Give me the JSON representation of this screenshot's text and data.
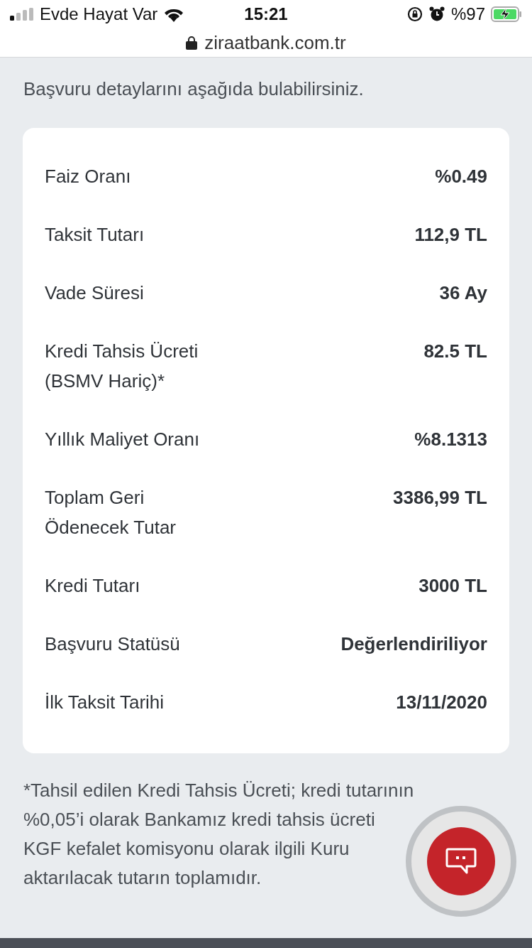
{
  "status_bar": {
    "carrier": "Evde Hayat Var",
    "time": "15:21",
    "battery": "%97"
  },
  "address_bar": {
    "url": "ziraatbank.com.tr"
  },
  "intro": "Başvuru detaylarını aşağıda bulabilirsiniz.",
  "details": [
    {
      "label": [
        "Faiz Oranı"
      ],
      "value": "%0.49"
    },
    {
      "label": [
        "Taksit Tutarı"
      ],
      "value": "112,9 TL"
    },
    {
      "label": [
        "Vade Süresi"
      ],
      "value": "36 Ay"
    },
    {
      "label": [
        "Kredi Tahsis Ücreti",
        "(BSMV Hariç)*"
      ],
      "value": "82.5 TL"
    },
    {
      "label": [
        "Yıllık Maliyet Oranı"
      ],
      "value": "%8.1313"
    },
    {
      "label": [
        "Toplam Geri",
        "Ödenecek Tutar"
      ],
      "value": "3386,99 TL"
    },
    {
      "label": [
        "Kredi Tutarı"
      ],
      "value": "3000 TL"
    },
    {
      "label": [
        "Başvuru Statüsü"
      ],
      "value": "Değerlendiriliyor"
    },
    {
      "label": [
        "İlk Taksit Tarihi"
      ],
      "value": "13/11/2020"
    }
  ],
  "footnote": [
    "*Tahsil edilen Kredi Tahsis Ücreti; kredi tutarının",
    "%0,05’i olarak Bankamız kredi tahsis ücreti",
    "KGF kefalet komisyonu olarak ilgili Kuru",
    "aktarılacak tutarın toplamıdır."
  ]
}
